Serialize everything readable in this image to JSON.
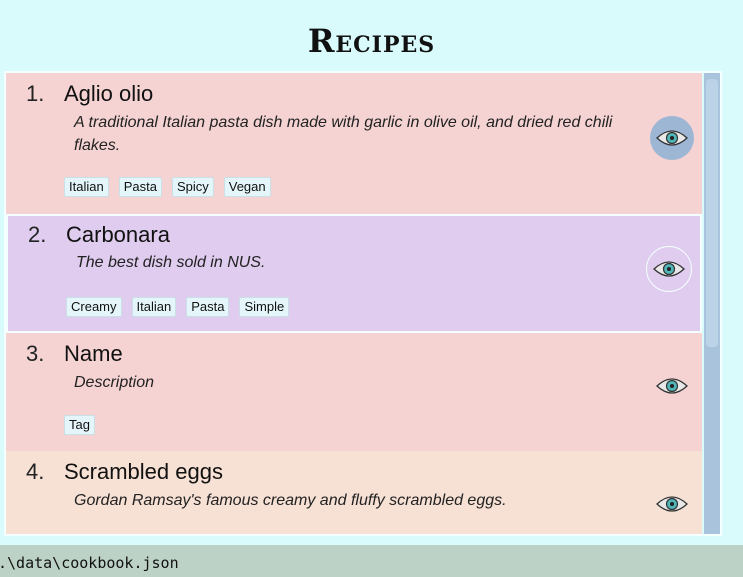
{
  "header": {
    "title": "Recipes"
  },
  "recipes": [
    {
      "index": "1.",
      "name": "Aglio olio",
      "description": "A traditional Italian pasta dish made with garlic in olive oil, and dried red chili flakes.",
      "tags": [
        "Italian",
        "Pasta",
        "Spicy",
        "Vegan"
      ],
      "background": "#f5d3d3"
    },
    {
      "index": "2.",
      "name": "Carbonara",
      "description": "The best dish sold in NUS.",
      "tags": [
        "Creamy",
        "Italian",
        "Pasta",
        "Simple"
      ],
      "background": "#dfccef"
    },
    {
      "index": "3.",
      "name": "Name",
      "description": "Description",
      "tags": [
        "Tag"
      ],
      "background": "#f5d3d3"
    },
    {
      "index": "4.",
      "name": "Scrambled eggs",
      "description": "Gordan Ramsay's famous creamy and fluffy scrambled eggs.",
      "tags": [],
      "background": "#f7e0d4"
    }
  ],
  "statusbar": {
    "path": ".\\data\\cookbook.json"
  },
  "colors": {
    "background": "#d9fbfb",
    "eye_hover": "#9cb6d4",
    "scrollbar": "#a9c3dc"
  },
  "icons": {
    "view": "eye-icon"
  }
}
